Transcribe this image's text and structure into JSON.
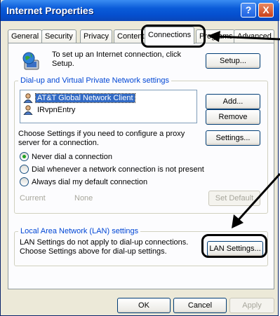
{
  "window": {
    "title": "Internet Properties",
    "help_label": "?",
    "close_label": "X"
  },
  "tabs": [
    {
      "label": "General"
    },
    {
      "label": "Security"
    },
    {
      "label": "Privacy"
    },
    {
      "label": "Content"
    },
    {
      "label": "Connections",
      "active": true
    },
    {
      "label": "Programs"
    },
    {
      "label": "Advanced"
    }
  ],
  "setup": {
    "text": "To set up an Internet connection, click Setup.",
    "button": "Setup..."
  },
  "dialup": {
    "group_label": "Dial-up and Virtual Private Network settings",
    "items": [
      {
        "label": "AT&T Global Network Client",
        "selected": true
      },
      {
        "label": "IRvpnEntry",
        "selected": false
      }
    ],
    "add_button": "Add...",
    "remove_button": "Remove",
    "proxy_text": "Choose Settings if you need to configure a proxy server for a connection.",
    "settings_button": "Settings...",
    "radios": [
      {
        "label": "Never dial a connection",
        "checked": true
      },
      {
        "label": "Dial whenever a network connection is not present",
        "checked": false
      },
      {
        "label": "Always dial my default connection",
        "checked": false
      }
    ],
    "current_label": "Current",
    "current_value": "None",
    "set_default_button": "Set Default"
  },
  "lan": {
    "group_label": "Local Area Network (LAN) settings",
    "text": "LAN Settings do not apply to dial-up connections. Choose Settings above for dial-up settings.",
    "button": "LAN Settings..."
  },
  "footer": {
    "ok": "OK",
    "cancel": "Cancel",
    "apply": "Apply"
  },
  "colors": {
    "titlebar": "#0550d0",
    "selection": "#316ac5",
    "group_label": "#0046d5",
    "callout": "#000000"
  }
}
